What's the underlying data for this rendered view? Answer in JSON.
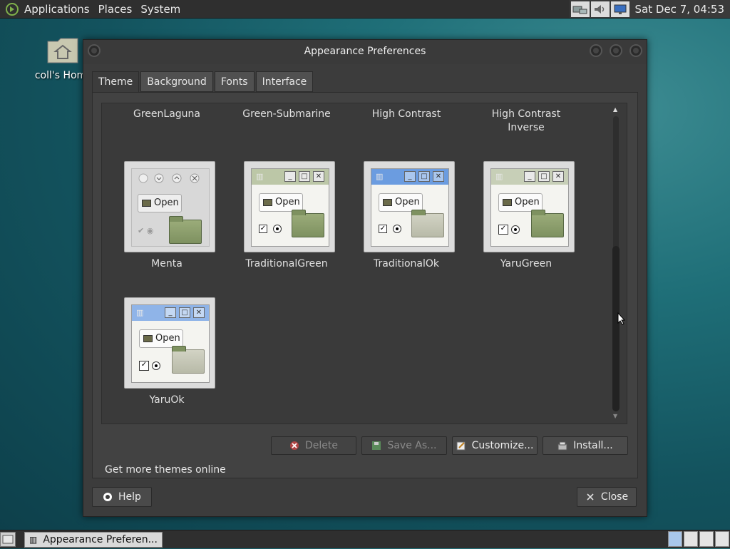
{
  "top_panel": {
    "menus": [
      "Applications",
      "Places",
      "System"
    ],
    "clock": "Sat Dec 7, 04:53"
  },
  "desktop": {
    "home_icon_label": "coll's Hom"
  },
  "window": {
    "title": "Appearance Preferences",
    "tabs": [
      "Theme",
      "Background",
      "Fonts",
      "Interface"
    ],
    "active_tab": "Theme",
    "themes_top_row": [
      "GreenLaguna",
      "Green-Submarine",
      "High Contrast",
      "High Contrast Inverse"
    ],
    "themes": [
      {
        "name": "Menta"
      },
      {
        "name": "TraditionalGreen"
      },
      {
        "name": "TraditionalOk"
      },
      {
        "name": "YaruGreen"
      },
      {
        "name": "YaruOk"
      }
    ],
    "thumb_open_label": "Open",
    "buttons": {
      "delete": "Delete",
      "save_as": "Save As...",
      "customize": "Customize...",
      "install": "Install..."
    },
    "more_themes_link": "Get more themes online",
    "help": "Help",
    "close": "Close"
  },
  "taskbar": {
    "task_label": "Appearance Preferen..."
  },
  "colors": {
    "panel_bg": "#2f2f2f",
    "window_bg": "#3c3c3c",
    "folder_green": "#8a9c6c",
    "titlebar_blue": "#5b8fd6"
  }
}
